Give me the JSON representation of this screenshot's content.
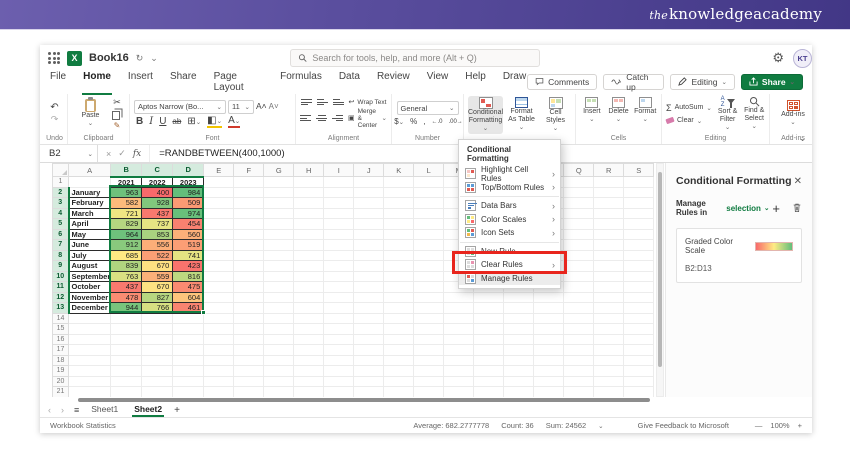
{
  "banner": {
    "logo_prefix": "the",
    "logo_text": "knowledgeacademy"
  },
  "window": {
    "titlebar": {
      "workbook": "Book16",
      "search_placeholder": "Search for tools, help, and more (Alt + Q)",
      "avatar_initials": "KT"
    },
    "menu_tabs": [
      {
        "label": "File"
      },
      {
        "label": "Home",
        "active": true
      },
      {
        "label": "Insert"
      },
      {
        "label": "Share"
      },
      {
        "label": "Page Layout"
      },
      {
        "label": "Formulas"
      },
      {
        "label": "Data"
      },
      {
        "label": "Review"
      },
      {
        "label": "View"
      },
      {
        "label": "Help"
      },
      {
        "label": "Draw"
      }
    ],
    "quick_actions": {
      "comments": "Comments",
      "catch_up": "Catch up",
      "editing": "Editing",
      "share": "Share"
    }
  },
  "ribbon": {
    "undo_label": "Undo",
    "clipboard": {
      "label": "Clipboard",
      "paste": "Paste"
    },
    "font": {
      "label": "Font",
      "name": "Aptos Narrow (Bo...",
      "size": "11"
    },
    "alignment": {
      "label": "Alignment",
      "wrap_text": "Wrap Text",
      "merge_center": "Merge & Center"
    },
    "number": {
      "label": "Number",
      "format": "General"
    },
    "styles": {
      "conditional_formatting": "Conditional Formatting",
      "format_as_table": "Format As Table",
      "cell_styles": "Cell Styles"
    },
    "cells": {
      "label": "Cells",
      "insert": "Insert",
      "delete": "Delete",
      "format": "Format"
    },
    "editing": {
      "label": "Editing",
      "autosum": "AutoSum",
      "clear": "Clear",
      "sort_filter": "Sort & Filter",
      "find_select": "Find & Select"
    },
    "addins": {
      "label": "Add-ins"
    }
  },
  "formula_bar": {
    "name_box": "B2",
    "formula": "=RANDBETWEEN(400,1000)"
  },
  "grid": {
    "visible_columns": [
      "A",
      "B",
      "C",
      "D",
      "E",
      "F",
      "G",
      "H",
      "I",
      "J",
      "K",
      "L",
      "M",
      "N",
      "O",
      "P",
      "Q",
      "R",
      "S"
    ],
    "selected_columns": [
      "B",
      "C",
      "D"
    ],
    "visible_rows": 21,
    "selected_rows_start": 2,
    "selected_rows_end": 13,
    "selection_range": "B2:D13",
    "header_years": [
      "2021",
      "2022",
      "2023"
    ],
    "months": [
      "January",
      "February",
      "March",
      "April",
      "May",
      "June",
      "July",
      "August",
      "September",
      "October",
      "November",
      "December"
    ],
    "values": [
      [
        963,
        400,
        984
      ],
      [
        582,
        928,
        509
      ],
      [
        721,
        437,
        974
      ],
      [
        829,
        737,
        454
      ],
      [
        964,
        853,
        560
      ],
      [
        912,
        556,
        519
      ],
      [
        685,
        522,
        741
      ],
      [
        839,
        670,
        423
      ],
      [
        763,
        559,
        816
      ],
      [
        437,
        670,
        475
      ],
      [
        478,
        827,
        604
      ],
      [
        944,
        766,
        461
      ]
    ],
    "color_scale": {
      "min_color": "#F8696B",
      "mid_color": "#FFEB84",
      "max_color": "#63BE7B"
    }
  },
  "cf_menu": {
    "header": "Conditional Formatting",
    "items": [
      {
        "label": "Highlight Cell Rules",
        "icon": "highlight-cell-rules",
        "submenu": true
      },
      {
        "label": "Top/Bottom Rules",
        "icon": "top-bottom-rules",
        "submenu": true
      },
      {
        "separator": true
      },
      {
        "label": "Data Bars",
        "icon": "data-bars",
        "submenu": true
      },
      {
        "label": "Color Scales",
        "icon": "color-scales",
        "submenu": true
      },
      {
        "label": "Icon Sets",
        "icon": "icon-sets",
        "submenu": true
      },
      {
        "separator": true
      },
      {
        "label": "New Rule",
        "icon": "new-rule"
      },
      {
        "label": "Clear Rules",
        "icon": "clear-rules",
        "submenu": true
      },
      {
        "label": "Manage Rules",
        "icon": "manage-rules",
        "highlighted": true
      }
    ]
  },
  "pane": {
    "title": "Conditional Formatting",
    "manage_rules_in": "Manage Rules in",
    "scope": "selection",
    "rule_name": "Graded Color Scale",
    "rule_range": "B2:D13"
  },
  "sheet_bar": {
    "sheets": [
      {
        "name": "Sheet1"
      },
      {
        "name": "Sheet2",
        "active": true
      }
    ]
  },
  "status_bar": {
    "left": "Workbook Statistics",
    "average": "Average: 682.2777778",
    "count": "Count: 36",
    "sum": "Sum: 24562",
    "feedback": "Give Feedback to Microsoft",
    "zoom": "100%"
  }
}
